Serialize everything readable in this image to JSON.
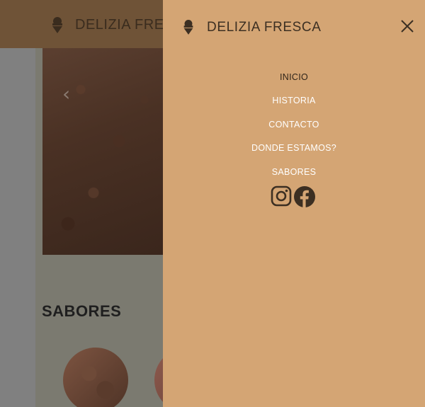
{
  "header": {
    "brand": "DELIZIA FRESCA",
    "logo_icon": "ice-cream-cone-icon"
  },
  "hero": {
    "prev_arrow": "‹"
  },
  "main": {
    "section_title": "SABORES"
  },
  "menu": {
    "brand": "DELIZIA FRESCA",
    "close_icon": "close-icon",
    "items": [
      {
        "label": "INICIO",
        "active": true
      },
      {
        "label": "HISTORIA",
        "active": false
      },
      {
        "label": "CONTACTO",
        "active": false
      },
      {
        "label": "DONDE ESTAMOS?",
        "active": false
      },
      {
        "label": "SABORES",
        "active": false
      }
    ],
    "social": [
      "instagram-icon",
      "facebook-icon"
    ]
  },
  "colors": {
    "header_bg": "#6f5337",
    "menu_bg": "#d4a574",
    "menu_text": "#ffffff",
    "menu_text_active": "#2f2419",
    "icon_dark": "#3c2f22"
  }
}
